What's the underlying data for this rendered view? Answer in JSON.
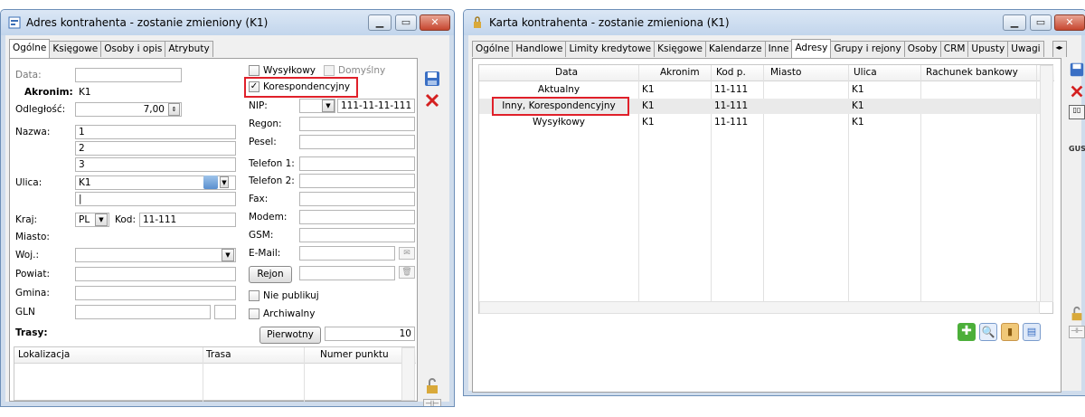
{
  "left_window": {
    "title": "Adres kontrahenta - zostanie zmieniony (K1)",
    "tabs": [
      "Ogólne",
      "Księgowe",
      "Osoby i opis",
      "Atrybuty"
    ],
    "labels": {
      "data": "Data:",
      "akronim": "Akronim:",
      "odleglosc": "Odległość:",
      "nazwa": "Nazwa:",
      "ulica": "Ulica:",
      "kraj": "Kraj:",
      "kod": "Kod:",
      "miasto": "Miasto:",
      "woj": "Woj.:",
      "powiat": "Powiat:",
      "gmina": "Gmina:",
      "gln": "GLN",
      "trasy": "Trasy:",
      "nip": "NIP:",
      "regon": "Regon:",
      "pesel": "Pesel:",
      "telefon1": "Telefon 1:",
      "telefon2": "Telefon 2:",
      "fax": "Fax:",
      "modem": "Modem:",
      "gsm": "GSM:",
      "email": "E-Mail:"
    },
    "values": {
      "akronim": "K1",
      "odleglosc": "7,00",
      "nazwa1": "1",
      "nazwa2": "2",
      "nazwa3": "3",
      "ulica": "K1",
      "kraj": "PL",
      "kod": "11-111",
      "nip": "111-11-11-111",
      "pierwotny_num": "10"
    },
    "checkboxes": {
      "wysylkowy": "Wysyłkowy",
      "domyslny": "Domyślny",
      "korespondencyjny": "Korespondencyjny",
      "nie_publikuj": "Nie publikuj",
      "archiwalny": "Archiwalny"
    },
    "buttons": {
      "rejon": "Rejon",
      "pierwotny": "Pierwotny"
    },
    "trasy_columns": [
      "Lokalizacja",
      "Trasa",
      "Numer punktu"
    ]
  },
  "right_window": {
    "title": "Karta kontrahenta - zostanie zmieniona (K1)",
    "tabs": [
      "Ogólne",
      "Handlowe",
      "Limity kredytowe",
      "Księgowe",
      "Kalendarze",
      "Inne",
      "Adresy",
      "Grupy i rejony",
      "Osoby",
      "CRM",
      "Upusty",
      "Uwagi"
    ],
    "columns": [
      "Data",
      "Akronim",
      "Kod p.",
      "Miasto",
      "Ulica",
      "Rachunek bankowy"
    ],
    "rows": [
      {
        "data": "Aktualny",
        "akronim": "K1",
        "kod": "11-111",
        "miasto": "",
        "ulica": "K1"
      },
      {
        "data": "Inny, Korespondencyjny",
        "akronim": "K1",
        "kod": "11-111",
        "miasto": "",
        "ulica": "K1"
      },
      {
        "data": "Wysyłkowy",
        "akronim": "K1",
        "kod": "11-111",
        "miasto": "",
        "ulica": "K1"
      }
    ]
  },
  "colors": {
    "highlight": "#e0202a",
    "save_blue": "#3a6fc4",
    "delete_red": "#d42020"
  }
}
